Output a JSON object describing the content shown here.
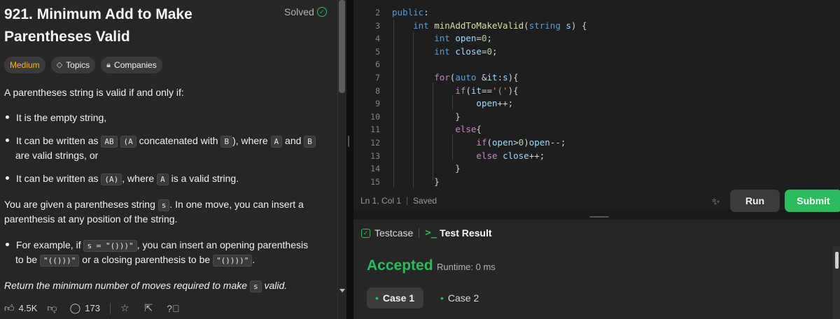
{
  "problem": {
    "title": "921. Minimum Add to Make Parentheses Valid",
    "solved_label": "Solved",
    "tags": {
      "difficulty": "Medium",
      "topics": "Topics",
      "companies": "Companies"
    },
    "intro": "A parentheses string is valid if and only if:",
    "bullet1": "It is the empty string,",
    "bullet2_a": "It can be written as ",
    "bullet2_code1": "AB",
    "bullet2_code2": "(A",
    "bullet2_b": " concatenated with ",
    "bullet2_code3": "B",
    "bullet2_c": "), where ",
    "bullet2_code4": "A",
    "bullet2_d": " and ",
    "bullet2_code5": "B",
    "bullet2_e": "are valid strings, or",
    "bullet3_a": "It can be written as ",
    "bullet3_code1": "(A)",
    "bullet3_b": ", where ",
    "bullet3_code2": "A",
    "bullet3_c": " is a valid string.",
    "para1_a": "You are given a parentheses string ",
    "para1_code": "s",
    "para1_b": ". In one move, you can insert a",
    "para1_c": "parenthesis at any position of the string.",
    "example_a": "For example, if ",
    "example_code1": "s = \"()))\"",
    "example_b": ", you can insert an opening parenthesis",
    "example_c": "to be ",
    "example_code2": "\"(()))\"",
    "example_d": " or a closing parenthesis to be ",
    "example_code3": "\"())))\"",
    "example_e": ".",
    "return_a": "Return the minimum number of moves required to make ",
    "return_code": "s",
    "return_b": " valid."
  },
  "footer": {
    "likes": "4.5K",
    "comments": "173"
  },
  "editor": {
    "line_numbers": [
      "2",
      "3",
      "4",
      "5",
      "6",
      "7",
      "8",
      "9",
      "10",
      "11",
      "12",
      "13",
      "14",
      "15"
    ],
    "status_position": "Ln 1, Col 1",
    "status_saved": "Saved"
  },
  "actions": {
    "run": "Run",
    "submit": "Submit"
  },
  "results": {
    "tab_testcase": "Testcase",
    "tab_test_result": "Test Result",
    "verdict": "Accepted",
    "runtime": "Runtime: 0 ms",
    "case1": "Case 1",
    "case2": "Case 2"
  },
  "colors": {
    "accent_green": "#2cbb5d",
    "medium": "#ffb800",
    "background": "#1a1a1a"
  }
}
